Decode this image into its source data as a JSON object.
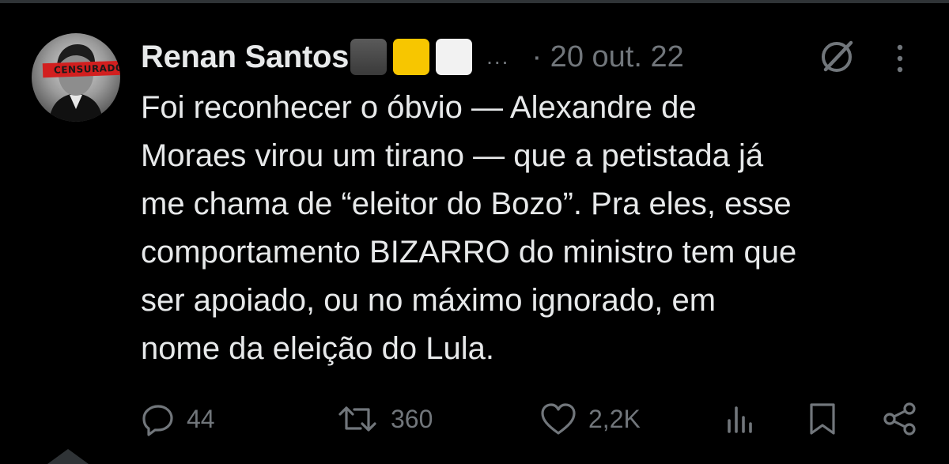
{
  "tweet": {
    "author_name": "Renan Santos",
    "name_badges": [
      {
        "color": "#444444"
      },
      {
        "color": "#f7c600"
      },
      {
        "color": "#f2f2f2"
      }
    ],
    "ellipsis": "...",
    "date": "· 20 out. 22",
    "avatar_label": "CENSURADO",
    "text": "Foi reconhecer o óbvio — Alexandre de\nMoraes virou um tirano — que a petistada já\nme chama de “eleitor do Bozo”. Pra eles, esse\ncomportamento BIZARRO do ministro tem que\nser apoiado, ou no máximo ignorado, em\nnome da eleição do Lula."
  },
  "header_icons": {
    "grok": "grok-icon",
    "more": "more-vertical-icon"
  },
  "actions": {
    "reply": {
      "icon": "reply-icon",
      "count": "44"
    },
    "retweet": {
      "icon": "retweet-icon",
      "count": "360"
    },
    "like": {
      "icon": "heart-icon",
      "count": "2,2K"
    },
    "views": {
      "icon": "views-icon"
    },
    "bookmark": {
      "icon": "bookmark-icon"
    },
    "share": {
      "icon": "share-icon"
    }
  },
  "colors": {
    "background": "#000000",
    "text_primary": "#e7e9ea",
    "text_secondary": "#71767b",
    "divider": "#2f3336",
    "censor_red": "#d21f1f"
  }
}
